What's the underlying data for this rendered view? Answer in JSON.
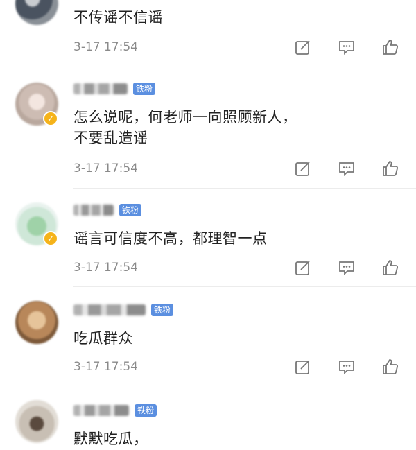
{
  "comments": [
    {
      "badge": "",
      "text": [
        "不传谣不信谣"
      ],
      "time": "3-17 17:54",
      "avatar_color": "#6f7a86"
    },
    {
      "badge": "铁粉",
      "text": [
        "怎么说呢，何老师一向照顾新人，",
        "不要乱造谣"
      ],
      "time": "3-17 17:54",
      "avatar_color": "#d7c9c0"
    },
    {
      "badge": "铁粉",
      "text": [
        "谣言可信度不高，都理智一点"
      ],
      "time": "3-17 17:54",
      "avatar_color": "#b9d8c3"
    },
    {
      "badge": "铁粉",
      "text": [
        "吃瓜群众"
      ],
      "time": "3-17 17:54",
      "avatar_color": "#c9a377"
    },
    {
      "badge": "铁粉",
      "text": [
        "默默吃瓜，"
      ],
      "time": "",
      "avatar_color": "#d9d4cc"
    }
  ],
  "icons": {
    "edit": "edit-icon",
    "comment": "comment-icon",
    "like": "like-icon"
  },
  "colors": {
    "badge_bg": "#5b8fe0",
    "verified": "#f5b31a",
    "meta": "#8a8a8a"
  }
}
